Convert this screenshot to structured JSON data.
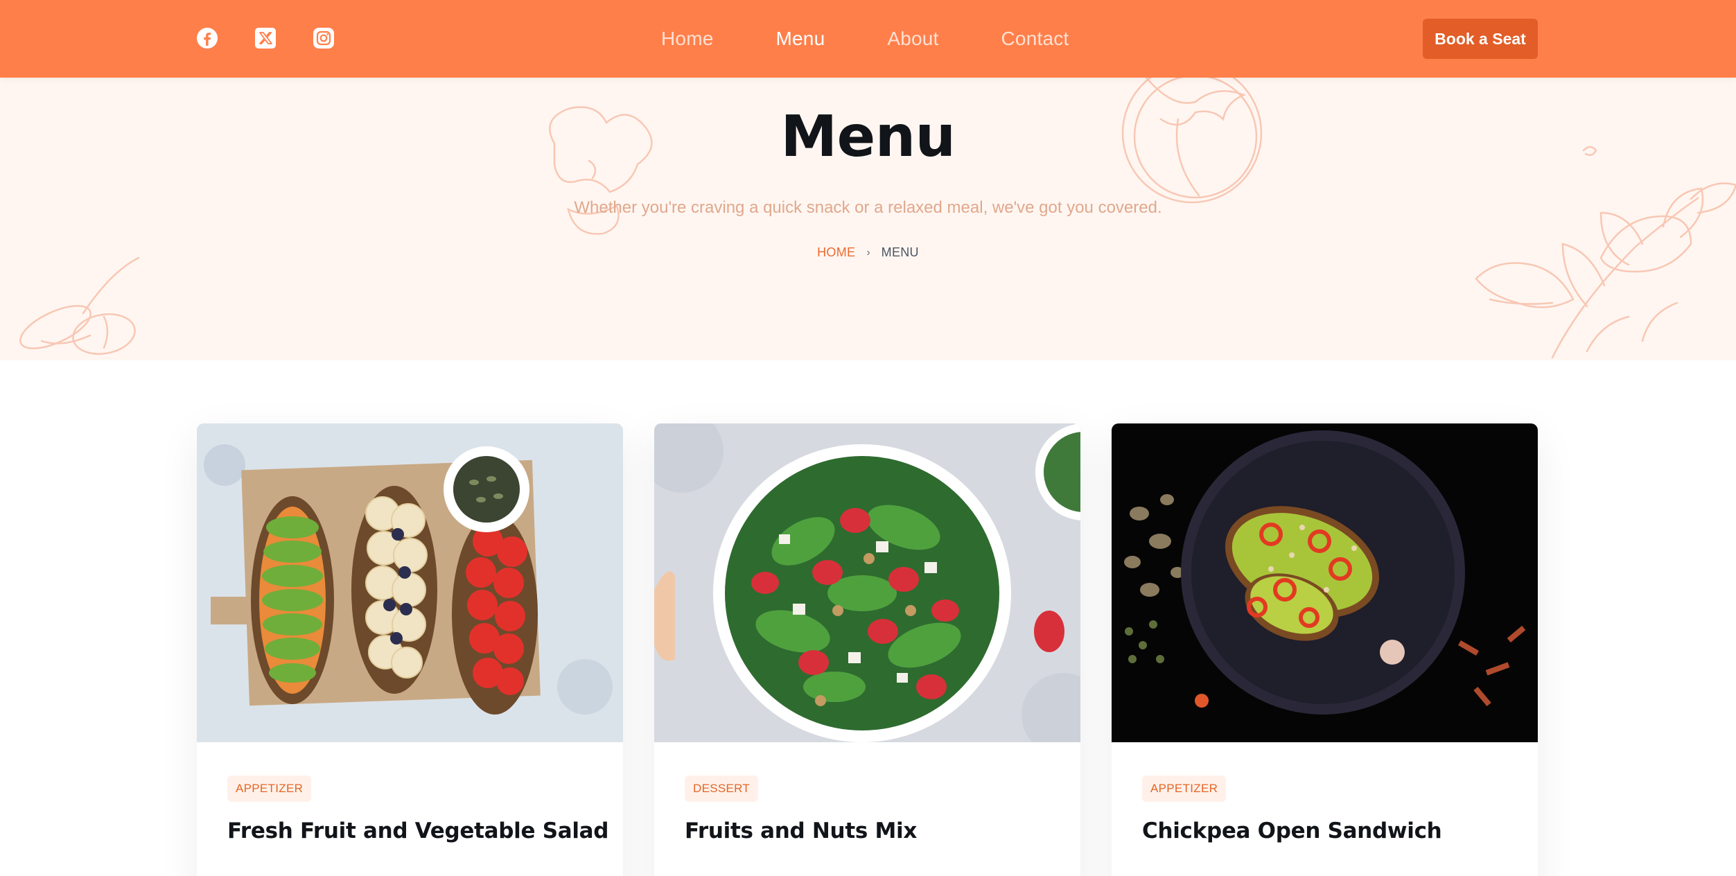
{
  "header": {
    "socials": [
      {
        "icon": "facebook-icon"
      },
      {
        "icon": "x-twitter-icon"
      },
      {
        "icon": "instagram-icon"
      }
    ],
    "nav": [
      {
        "label": "Home",
        "active": false
      },
      {
        "label": "Menu",
        "active": true
      },
      {
        "label": "About",
        "active": false
      },
      {
        "label": "Contact",
        "active": false
      }
    ],
    "cta_label": "Book a Seat"
  },
  "hero": {
    "title": "Menu",
    "subtitle": "Whether you're craving a quick snack or a relaxed meal, we've got you covered.",
    "breadcrumb": {
      "home": "HOME",
      "separator": "›",
      "current": "MENU"
    }
  },
  "menu_items": [
    {
      "category": "APPETIZER",
      "title": "Fresh Fruit and Vegetable Salad",
      "image": "avocado-banana-tomato-toasts"
    },
    {
      "category": "DESSERT",
      "title": "Fruits and Nuts Mix",
      "image": "strawberry-spinach-salad-bowl"
    },
    {
      "category": "APPETIZER",
      "title": "Chickpea Open Sandwich",
      "image": "avocado-toast-on-dark-plate"
    }
  ],
  "colors": {
    "brand": "#ff7f4a",
    "cta": "#e25d27",
    "hero_bg": "#fff6f1",
    "tag_bg": "#fff1ea",
    "tag_text": "#e56526"
  }
}
